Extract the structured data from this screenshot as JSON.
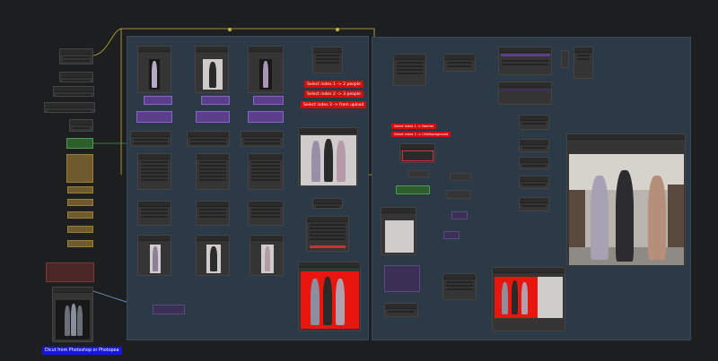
{
  "canvas": {
    "background": "#1d1e1f"
  },
  "groups": {
    "left": {
      "title": ""
    },
    "right": {
      "title": ""
    }
  },
  "notes": {
    "select_1": "Select index 1 -> 2 people",
    "select_2": "Select index 2 -> 3 people",
    "select_3": "Select index 3 -> from upload",
    "small_1": "Select index 1 -> Normal",
    "small_2": "Select index 2 -> Unit/background",
    "footer": "Dicut from Photoshop or Photopea"
  },
  "colors": {
    "group_bg": "#2c3a47",
    "node_bg": "#353535",
    "wire_yellow": "#c9b53a",
    "wire_blue": "#7aa6d6",
    "note_red": "#d40d0d",
    "note_blue": "#1614e6",
    "purple_node": "#5b3f8a",
    "green_node": "#2e5e2e",
    "gold_node": "#6e5a2c"
  },
  "icons": {
    "figure": "character-figure-icon"
  }
}
